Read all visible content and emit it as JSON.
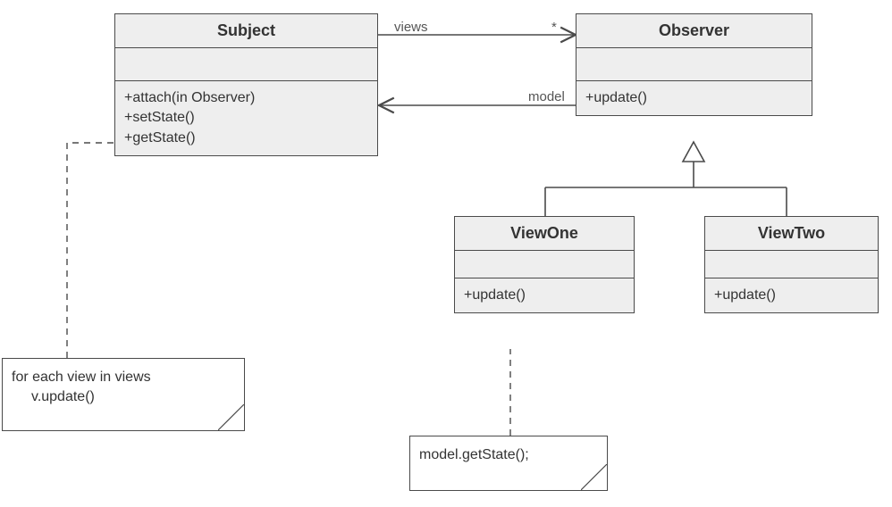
{
  "classes": {
    "subject": {
      "name": "Subject",
      "ops": [
        "+attach(in Observer)",
        "+setState()",
        "+getState()"
      ]
    },
    "observer": {
      "name": "Observer",
      "ops": [
        "+update()"
      ]
    },
    "viewOne": {
      "name": "ViewOne",
      "ops": [
        "+update()"
      ]
    },
    "viewTwo": {
      "name": "ViewTwo",
      "ops": [
        "+update()"
      ]
    }
  },
  "associations": {
    "views": {
      "label": "views",
      "multiplicity": "*"
    },
    "model": {
      "label": "model"
    }
  },
  "notes": {
    "subjectNote": {
      "line1": "for each view in views",
      "line2": "v.update()"
    },
    "viewOneNote": {
      "text": "model.getState();"
    }
  }
}
